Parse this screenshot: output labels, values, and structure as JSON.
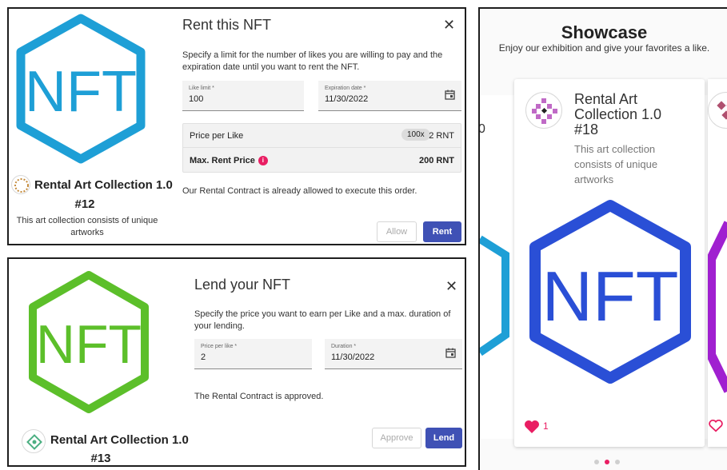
{
  "rent_card": {
    "collection": "Rental Art Collection 1.0",
    "token": "#12",
    "description": "This art collection consists of unique artworks",
    "art_text": "NFT",
    "art_color": "#1e9fd6"
  },
  "rent_dialog": {
    "title": "Rent this NFT",
    "close_icon": "close-icon",
    "description": "Specify a limit for the number of likes you are willing to pay and the expiration date until you want to rent the NFT.",
    "like_limit_label": "Like limit *",
    "like_limit_value": "100",
    "expiration_label": "Expiration date *",
    "expiration_value": "11/30/2022",
    "price_per_like_label": "Price per Like",
    "price_chip": "100x",
    "price_per_like_value": "2 RNT",
    "max_rent_label": "Max. Rent Price",
    "max_rent_value": "200 RNT",
    "info_icon": "i",
    "note": "Our Rental Contract is already allowed to execute this order.",
    "allow_button": "Allow",
    "rent_button": "Rent"
  },
  "lend_card": {
    "collection": "Rental Art Collection 1.0",
    "token": "#13",
    "art_text": "NFT",
    "art_color": "#5cbf2a"
  },
  "lend_dialog": {
    "title": "Lend your NFT",
    "description": "Specify the price you want to earn per Like and a max. duration of your lending.",
    "price_label": "Price per like *",
    "price_value": "2",
    "duration_label": "Duration *",
    "duration_value": "11/30/2022",
    "note": "The Rental Contract is approved.",
    "approve_button": "Approve",
    "lend_button": "Lend"
  },
  "showcase": {
    "title": "Showcase",
    "subtitle": "Enjoy our exhibition and give your favorites a like.",
    "card_title_lines": [
      "Rental Art",
      "Collection 1.0",
      "#18"
    ],
    "card_desc_lines": [
      "This art collection",
      "consists of unique",
      "artworks"
    ],
    "art_text": "NFT",
    "art_color": "#2a4fd6",
    "likes": "1",
    "peek_left_text": "0",
    "heart_color": "#e91e63",
    "carousel_active_index": 1,
    "carousel_count": 3
  }
}
